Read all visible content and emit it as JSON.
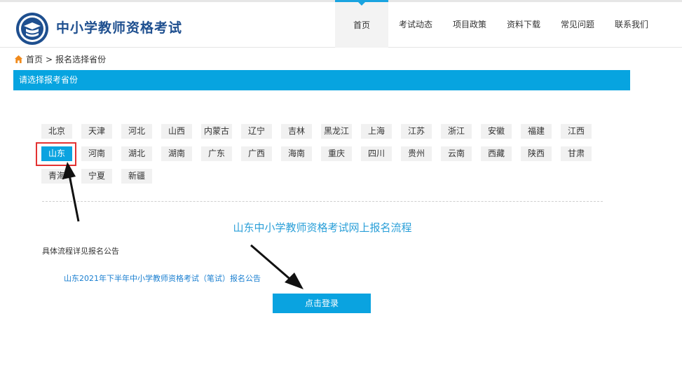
{
  "header": {
    "site_title": "中小学教师资格考试",
    "logo_icon": "school-emblem-logo"
  },
  "nav": {
    "items": [
      {
        "label": "首页",
        "active": true
      },
      {
        "label": "考试动态",
        "active": false
      },
      {
        "label": "项目政策",
        "active": false
      },
      {
        "label": "资料下载",
        "active": false
      },
      {
        "label": "常见问题",
        "active": false
      },
      {
        "label": "联系我们",
        "active": false
      }
    ],
    "accent_color": "#1aa4e0"
  },
  "breadcrumb": {
    "home_icon": "home-icon",
    "home": "首页",
    "separator": ">",
    "current": "报名选择省份"
  },
  "section": {
    "title": "请选择报考省份",
    "color": "#07a4e0"
  },
  "provinces": {
    "selected": "山东",
    "items": [
      "北京",
      "天津",
      "河北",
      "山西",
      "内蒙古",
      "辽宁",
      "吉林",
      "黑龙江",
      "上海",
      "江苏",
      "浙江",
      "安徽",
      "福建",
      "江西",
      "山东",
      "河南",
      "湖北",
      "湖南",
      "广东",
      "广西",
      "海南",
      "重庆",
      "四川",
      "贵州",
      "云南",
      "西藏",
      "陕西",
      "甘肃",
      "青海",
      "宁夏",
      "新疆"
    ]
  },
  "content": {
    "flow_title": "山东中小学教师资格考试网上报名流程",
    "detail_note": "具体流程详见报名公告",
    "notice_link": "山东2021年下半年中小学教师资格考试（笔试）报名公告",
    "login_button": "点击登录"
  }
}
